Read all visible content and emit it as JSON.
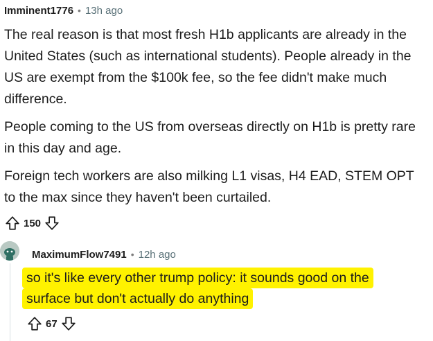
{
  "comment": {
    "author": "Imminent1776",
    "separator": "•",
    "time": "13h ago",
    "paragraphs": [
      "The real reason is that most fresh H1b applicants are already in the United States (such as international students). People already in the US are exempt from the $100k fee, so the fee didn't make much difference.",
      "People coming to the US from overseas directly on H1b is pretty rare in this day and age.",
      "Foreign tech workers are also milking L1 visas, H4 EAD, STEM OPT to the max since they haven't been curtailed."
    ],
    "score": "150"
  },
  "reply": {
    "author": "MaximumFlow7491",
    "separator": "•",
    "time": "12h ago",
    "lines": [
      "so it's like every other trump policy: it sounds good on the",
      "surface but don't actually do anything"
    ],
    "highlight_color": "#fff200",
    "score": "67"
  },
  "icons": {
    "upvote": "upvote-arrow-icon",
    "downvote": "downvote-arrow-icon",
    "avatar": "snoo-avatar-icon"
  }
}
